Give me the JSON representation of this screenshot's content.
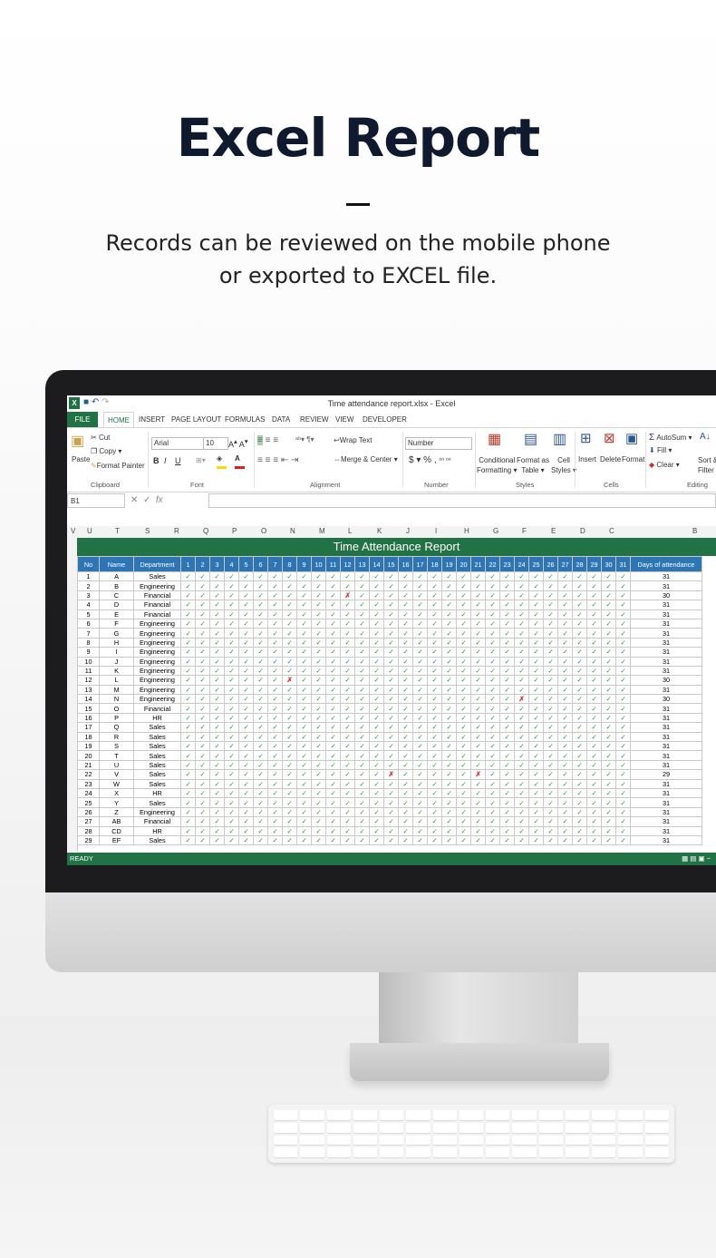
{
  "hero": {
    "title": "Excel Report",
    "subtitle_line1": "Records can be reviewed on the mobile phone",
    "subtitle_line2": "or exported to EXCEL file."
  },
  "excel": {
    "window_title": "Time attendance report.xlsx - Excel",
    "tabs": [
      "FILE",
      "HOME",
      "INSERT",
      "PAGE LAYOUT",
      "FORMULAS",
      "DATA",
      "REVIEW",
      "VIEW",
      "DEVELOPER"
    ],
    "clipboard": {
      "paste": "Paste",
      "cut": "Cut",
      "copy": "Copy",
      "format_painter": "Format Painter",
      "label": "Clipboard"
    },
    "font": {
      "name": "Arial",
      "size": "10",
      "label": "Font",
      "bold": "B",
      "italic": "I",
      "underline": "U"
    },
    "alignment": {
      "wrap": "Wrap Text",
      "merge": "Merge & Center",
      "label": "Alignment"
    },
    "number": {
      "format": "Number",
      "currency": "$",
      "percent": "%",
      "comma": ",",
      "label": "Number"
    },
    "styles": {
      "conditional": "Conditional",
      "conditional2": "Formatting",
      "format_table": "Format as",
      "format_table2": "Table",
      "cell_styles": "Cell",
      "cell_styles2": "Styles",
      "label": "Styles"
    },
    "cells": {
      "insert": "Insert",
      "delete": "Delete",
      "format": "Format",
      "label": "Cells"
    },
    "editing": {
      "autosum": "AutoSum",
      "fill": "Fill",
      "clear": "Clear",
      "sort": "Sort &",
      "filter": "Filter",
      "label": "Editing"
    },
    "name_box": "B1",
    "fx": "fx",
    "column_letters": [
      "V",
      "U",
      "T",
      "S",
      "R",
      "Q",
      "P",
      "O",
      "N",
      "M",
      "L",
      "K",
      "J",
      "I",
      "H",
      "G",
      "F",
      "E",
      "D",
      "C",
      "B"
    ],
    "status": "READY"
  },
  "report": {
    "title": "Time Attendance Report",
    "headers": {
      "no": "No",
      "name": "Name",
      "department": "Department",
      "days": "Days of attendance"
    },
    "day_numbers": [
      "1",
      "2",
      "3",
      "4",
      "5",
      "6",
      "7",
      "8",
      "9",
      "10",
      "11",
      "12",
      "13",
      "14",
      "15",
      "16",
      "17",
      "18",
      "19",
      "20",
      "21",
      "22",
      "23",
      "24",
      "25",
      "26",
      "27",
      "28",
      "29",
      "30",
      "31"
    ],
    "present_mark": "✓",
    "absent_mark": "✗",
    "rows": [
      {
        "no": "1",
        "name": "A",
        "dept": "Sales",
        "days": "31",
        "absent": []
      },
      {
        "no": "2",
        "name": "B",
        "dept": "Engineering",
        "days": "31",
        "absent": []
      },
      {
        "no": "3",
        "name": "C",
        "dept": "Financial",
        "days": "30",
        "absent": [
          12
        ]
      },
      {
        "no": "4",
        "name": "D",
        "dept": "Financial",
        "days": "31",
        "absent": []
      },
      {
        "no": "5",
        "name": "E",
        "dept": "Financial",
        "days": "31",
        "absent": []
      },
      {
        "no": "6",
        "name": "F",
        "dept": "Engineering",
        "days": "31",
        "absent": []
      },
      {
        "no": "7",
        "name": "G",
        "dept": "Engineering",
        "days": "31",
        "absent": []
      },
      {
        "no": "8",
        "name": "H",
        "dept": "Engineering",
        "days": "31",
        "absent": []
      },
      {
        "no": "9",
        "name": "I",
        "dept": "Engineering",
        "days": "31",
        "absent": []
      },
      {
        "no": "10",
        "name": "J",
        "dept": "Engineering",
        "days": "31",
        "absent": []
      },
      {
        "no": "11",
        "name": "K",
        "dept": "Engineering",
        "days": "31",
        "absent": []
      },
      {
        "no": "12",
        "name": "L",
        "dept": "Engineering",
        "days": "30",
        "absent": [
          8
        ]
      },
      {
        "no": "13",
        "name": "M",
        "dept": "Engineering",
        "days": "31",
        "absent": []
      },
      {
        "no": "14",
        "name": "N",
        "dept": "Engineering",
        "days": "30",
        "absent": [
          24
        ]
      },
      {
        "no": "15",
        "name": "O",
        "dept": "Financial",
        "days": "31",
        "absent": []
      },
      {
        "no": "16",
        "name": "P",
        "dept": "HR",
        "days": "31",
        "absent": []
      },
      {
        "no": "17",
        "name": "Q",
        "dept": "Sales",
        "days": "31",
        "absent": []
      },
      {
        "no": "18",
        "name": "R",
        "dept": "Sales",
        "days": "31",
        "absent": []
      },
      {
        "no": "19",
        "name": "S",
        "dept": "Sales",
        "days": "31",
        "absent": []
      },
      {
        "no": "20",
        "name": "T",
        "dept": "Sales",
        "days": "31",
        "absent": []
      },
      {
        "no": "21",
        "name": "U",
        "dept": "Sales",
        "days": "31",
        "absent": []
      },
      {
        "no": "22",
        "name": "V",
        "dept": "Sales",
        "days": "29",
        "absent": [
          15,
          21
        ]
      },
      {
        "no": "23",
        "name": "W",
        "dept": "Sales",
        "days": "31",
        "absent": []
      },
      {
        "no": "24",
        "name": "X",
        "dept": "HR",
        "days": "31",
        "absent": []
      },
      {
        "no": "25",
        "name": "Y",
        "dept": "Sales",
        "days": "31",
        "absent": []
      },
      {
        "no": "26",
        "name": "Z",
        "dept": "Engineering",
        "days": "31",
        "absent": []
      },
      {
        "no": "27",
        "name": "AB",
        "dept": "Financial",
        "days": "31",
        "absent": []
      },
      {
        "no": "28",
        "name": "CD",
        "dept": "HR",
        "days": "31",
        "absent": []
      },
      {
        "no": "29",
        "name": "EF",
        "dept": "Sales",
        "days": "31",
        "absent": []
      }
    ]
  }
}
